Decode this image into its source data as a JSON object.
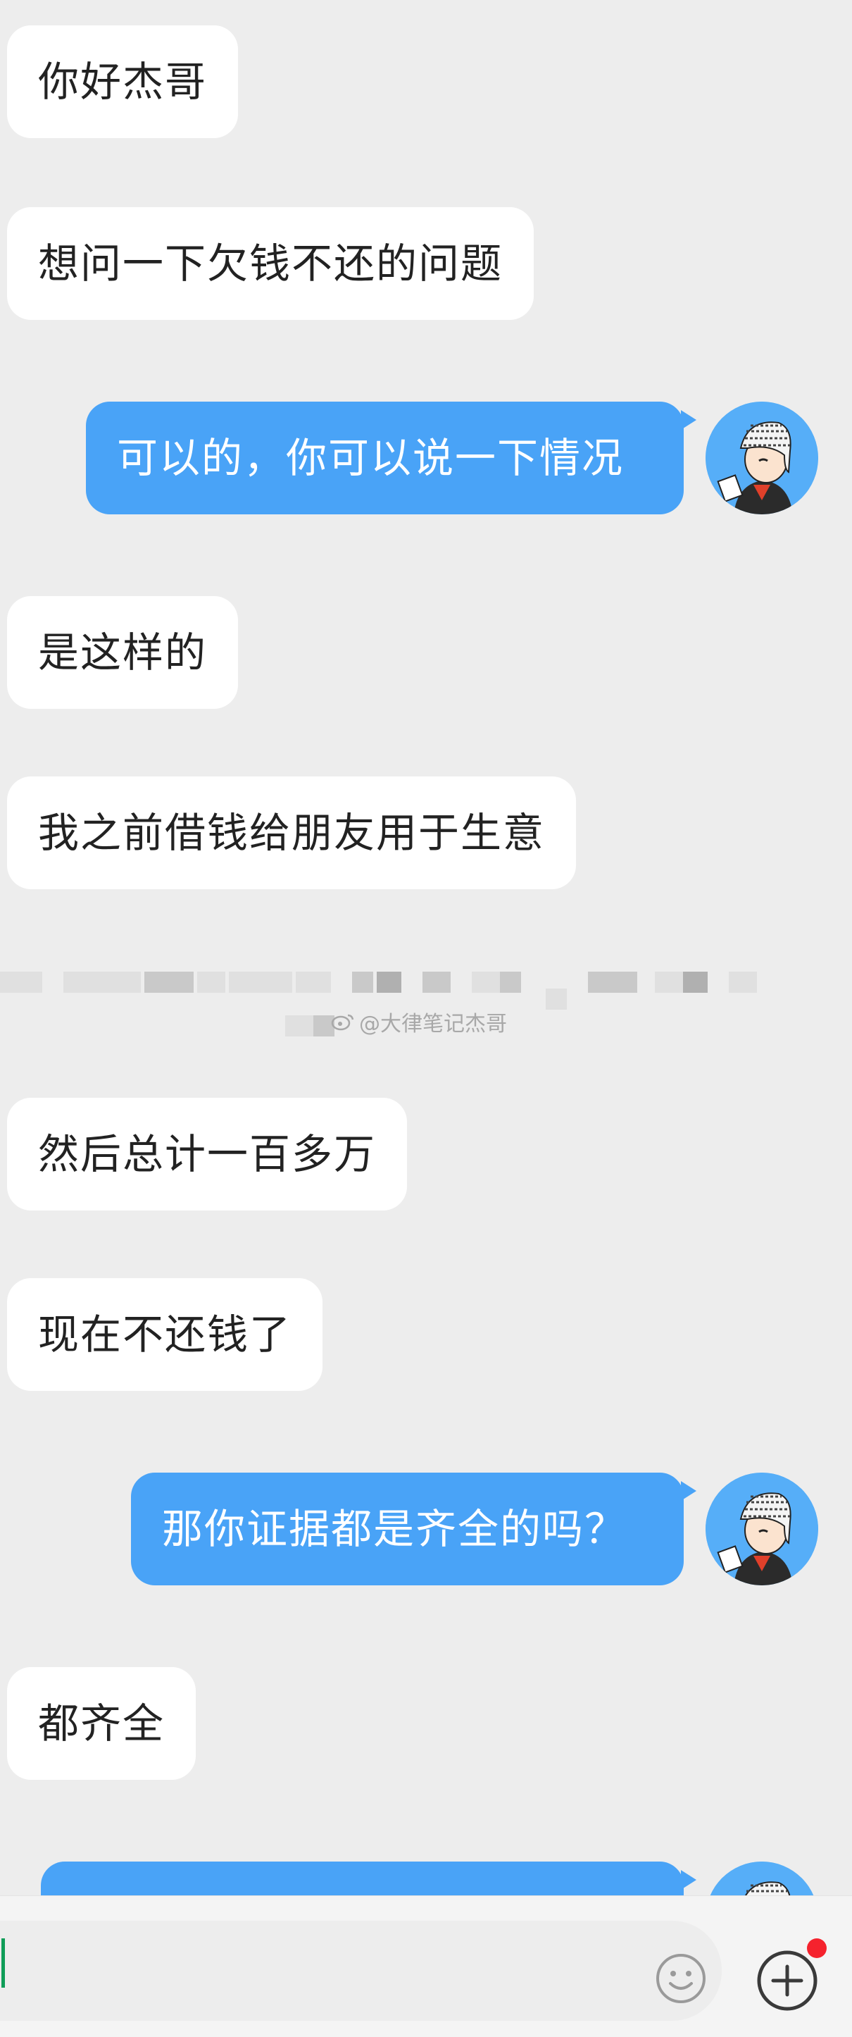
{
  "chat": {
    "messages": [
      {
        "side": "in",
        "text": "你好杰哥"
      },
      {
        "side": "in",
        "text": "想问一下欠钱不还的问题"
      },
      {
        "side": "out",
        "text": "可以的，你可以说一下情况"
      },
      {
        "side": "in",
        "text": "是这样的"
      },
      {
        "side": "in",
        "text": "我之前借钱给朋友用于生意"
      },
      {
        "side": "in",
        "text": "然后总计一百多万"
      },
      {
        "side": "in",
        "text": "现在不还钱了"
      },
      {
        "side": "out",
        "text": "那你证据都是齐全的吗？"
      },
      {
        "side": "in",
        "text": "都齐全"
      },
      {
        "side": "out",
        "text": ""
      }
    ]
  },
  "watermark": {
    "text": "@大律笔记杰哥",
    "icon": "weibo-icon"
  },
  "input_bar": {
    "emoji_icon": "smile-icon",
    "plus_icon": "plus-circle-icon",
    "badge_color": "#f5222d"
  },
  "colors": {
    "background": "#ededed",
    "incoming_bubble": "#ffffff",
    "outgoing_bubble": "#49a3f7",
    "avatar_bg": "#56aef8"
  }
}
